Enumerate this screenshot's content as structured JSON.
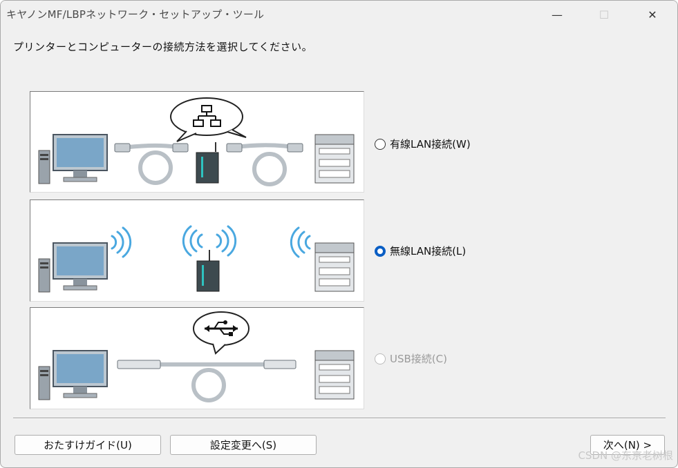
{
  "window": {
    "title": "キヤノンMF/LBPネットワーク・セットアップ・ツール",
    "controls": {
      "minimize": "—",
      "maximize": "☐",
      "close": "✕"
    }
  },
  "instruction": "プリンターとコンピューターの接続方法を選択してください。",
  "options": [
    {
      "label": "有線LAN接続(W)",
      "selected": false,
      "enabled": true
    },
    {
      "label": "無線LAN接続(L)",
      "selected": true,
      "enabled": true
    },
    {
      "label": "USB接続(C)",
      "selected": false,
      "enabled": false
    }
  ],
  "buttons": {
    "guide": "おたすけガイド(U)",
    "settings": "設定変更へ(S)",
    "next": "次へ(N) >"
  },
  "watermark": "CSDN @东京老树根",
  "colors": {
    "radio_selected": "#0a5ec4",
    "wireless_wave": "#4aa8e0",
    "cable": "#b9c0c6"
  }
}
